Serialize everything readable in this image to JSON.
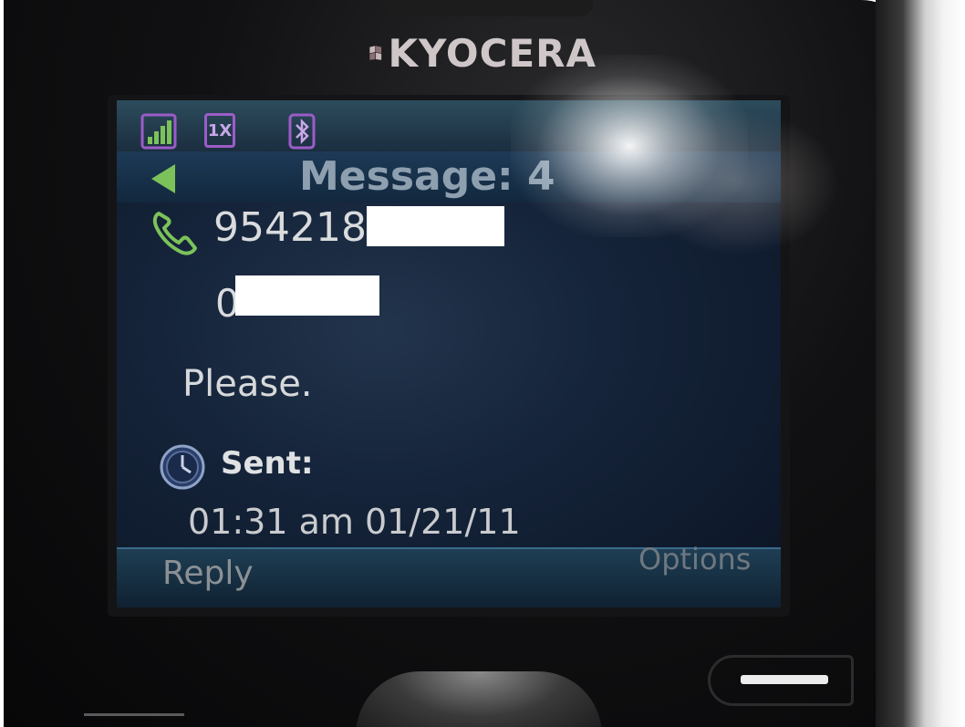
{
  "device": {
    "brand": "KYOCERA"
  },
  "status_bar": {
    "icons": [
      "signal-icon",
      "1x-icon",
      "bluetooth-icon"
    ],
    "network_label": "1X"
  },
  "header": {
    "title": "Message: 4",
    "back_icon": "back-arrow-icon"
  },
  "message": {
    "sender_icon": "phone-icon",
    "sender_number": "954218",
    "second_line": "0",
    "body": "Please.",
    "sent_icon": "clock-icon",
    "sent_label": "Sent:",
    "sent_time": "01:31 am 01/21/11"
  },
  "softkeys": {
    "left": "Reply",
    "right": "Options"
  },
  "colors": {
    "accent_green": "#7cc25a",
    "icon_purple": "#9c5cc8",
    "screen_bg": "#15243a"
  }
}
